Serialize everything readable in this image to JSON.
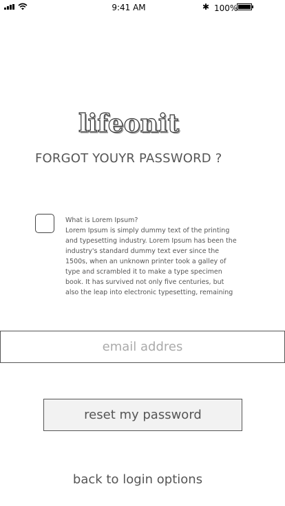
{
  "status_bar": {
    "time": "9:41 AM",
    "battery_percent": "100%",
    "bluetooth_glyph": "✱"
  },
  "logo": {
    "text": "lifeonit"
  },
  "heading": "FORGOT YOUYR PASSWORD ?",
  "info": {
    "title": "What is Lorem Ipsum?",
    "body": "Lorem Ipsum is simply dummy text of the printing and typesetting industry. Lorem Ipsum has been the industry's standard dummy text ever since the 1500s, when an unknown printer took a galley of type and scrambled it to make a type specimen book. It has survived not only five centuries, but also the leap into electronic typesetting, remaining"
  },
  "email": {
    "placeholder": "email addres",
    "value": ""
  },
  "reset_button_label": "reset my password",
  "back_link_label": "back to login options"
}
